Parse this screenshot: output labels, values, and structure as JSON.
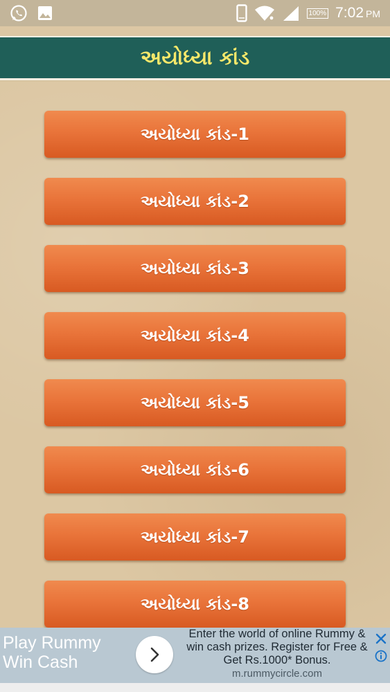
{
  "status_bar": {
    "time": "7:02",
    "ampm": "PM",
    "battery": "100%",
    "icons": [
      "whatsapp-icon",
      "image-icon",
      "phone-icon",
      "wifi-icon",
      "signal-icon",
      "battery-icon"
    ]
  },
  "header": {
    "title": "અયોધ્યા કાંડ",
    "bg_color": "#1f5f58",
    "title_color": "#f7e86a"
  },
  "menu": {
    "button_color": "#e9743a",
    "items": [
      {
        "label": "અયોધ્યા કાંડ-1"
      },
      {
        "label": "અયોધ્યા કાંડ-2"
      },
      {
        "label": "અયોધ્યા કાંડ-3"
      },
      {
        "label": "અયોધ્યા કાંડ-4"
      },
      {
        "label": "અયોધ્યા કાંડ-5"
      },
      {
        "label": "અયોધ્યા કાંડ-6"
      },
      {
        "label": "અયોધ્યા કાંડ-7"
      },
      {
        "label": "અયોધ્યા કાંડ-8"
      }
    ]
  },
  "ad": {
    "headline_line1": "Play Rummy",
    "headline_line2": "Win Cash",
    "body_line1": "Enter the world of online Rummy &",
    "body_line2": "win cash prizes. Register for Free &",
    "body_line3": "Get Rs.1000* Bonus.",
    "url": "m.rummycircle.com",
    "icons": [
      "chevron-right-icon",
      "close-icon",
      "info-icon"
    ]
  }
}
